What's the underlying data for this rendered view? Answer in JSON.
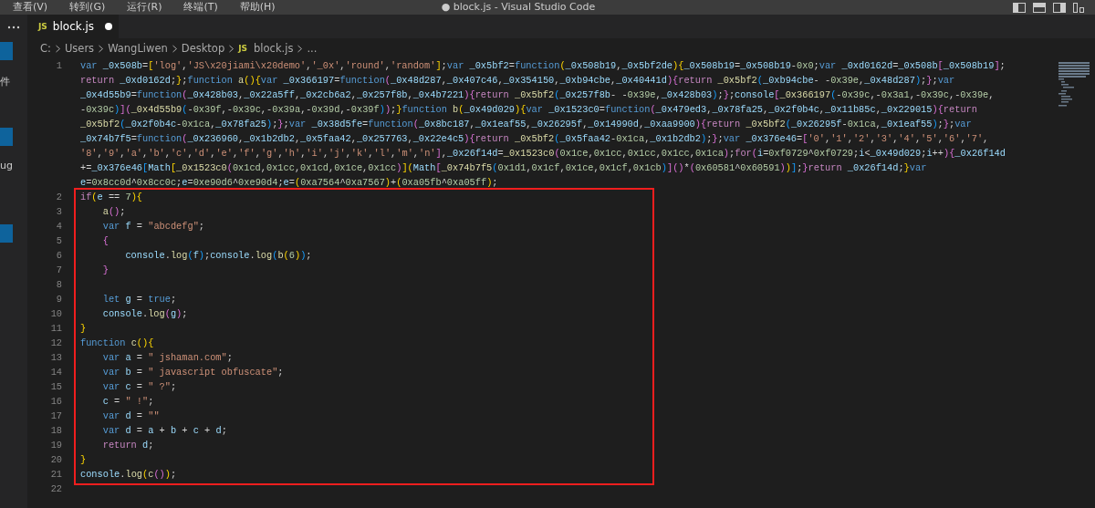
{
  "menu_bar": {
    "items": [
      "查看(V)",
      "转到(G)",
      "运行(R)",
      "终端(T)",
      "帮助(H)"
    ],
    "title": "● block.js - Visual Studio Code"
  },
  "sidebar": {
    "labels": [
      "件",
      "ug"
    ]
  },
  "tabs": [
    {
      "icon_label": "JS",
      "label": "block.js",
      "selected": true,
      "unsaved": true
    }
  ],
  "breadcrumb": [
    {
      "text": "C:"
    },
    {
      "text": "Users"
    },
    {
      "text": "WangLiwen"
    },
    {
      "text": "Desktop"
    },
    {
      "icon_label": "JS",
      "text": "block.js"
    },
    {
      "text": "..."
    }
  ],
  "editor": {
    "lines": [
      {
        "number": "1",
        "rows": [
          "var _0x508b=['log','JS\\x20jiami\\x20demo','_0x','round','random'];var _0x5bf2=function(_0x508b19,_0x5bf2de){_0x508b19=_0x508b19-0x0;var _0xd0162d=_0x508b[_0x508b19];",
          "return _0xd0162d;};function a(){var _0x366197=function(_0x48d287,_0x407c46,_0x354150,_0xb94cbe,_0x40441d){return _0x5bf2(_0xb94cbe- -0x39e,_0x48d287);};var",
          "_0x4d55b9=function(_0x428b03,_0x22a5ff,_0x2cb6a2,_0x257f8b,_0x4b7221){return _0x5bf2(_0x257f8b- -0x39e,_0x428b03);};console[_0x366197(-0x39c,-0x3a1,-0x39c,-0x39e,",
          "-0x39c)](_0x4d55b9(-0x39f,-0x39c,-0x39a,-0x39d,-0x39f));}function b(_0x49d029){var _0x1523c0=function(_0x479ed3,_0x78fa25,_0x2f0b4c,_0x11b85c,_0x229015){return",
          "_0x5bf2(_0x2f0b4c-0x1ca,_0x78fa25);};var _0x38d5fe=function(_0x8bc187,_0x1eaf55,_0x26295f,_0x14990d,_0xaa9900){return _0x5bf2(_0x26295f-0x1ca,_0x1eaf55);};var",
          "_0x74b7f5=function(_0x236960,_0x1b2db2,_0x5faa42,_0x257763,_0x22e4c5){return _0x5bf2(_0x5faa42-0x1ca,_0x1b2db2);};var _0x376e46=['0','1','2','3','4','5','6','7',",
          "'8','9','a','b','c','d','e','f','g','h','i','j','k','l','m','n'],_0x26f14d=_0x1523c0(0x1ce,0x1cc,0x1cc,0x1cc,0x1ca);for(i=0xf0729^0xf0729;i<_0x49d029;i++){_0x26f14d",
          "+=_0x376e46[Math[_0x1523c0(0x1cd,0x1cc,0x1cd,0x1ce,0x1cc)](Math[_0x74b7f5(0x1d1,0x1cf,0x1ce,0x1cf,0x1cb)]()*(0x60581^0x60591))];}return _0x26f14d;}var",
          "e=0x8cc0d^0x8cc0c;e=0xe90d6^0xe90d4;e=(0xa7564^0xa7567)+(0xa05fb^0xa05ff);"
        ]
      },
      {
        "number": "2",
        "rows": [
          "if(e == 7){"
        ]
      },
      {
        "number": "3",
        "rows": [
          "    a();"
        ]
      },
      {
        "number": "4",
        "rows": [
          "    var f = \"abcdefg\";"
        ]
      },
      {
        "number": "5",
        "rows": [
          "    {"
        ]
      },
      {
        "number": "6",
        "rows": [
          "        console.log(f);console.log(b(6));"
        ]
      },
      {
        "number": "7",
        "rows": [
          "    }"
        ]
      },
      {
        "number": "8",
        "rows": [
          ""
        ]
      },
      {
        "number": "9",
        "rows": [
          "    let g = true;"
        ]
      },
      {
        "number": "10",
        "rows": [
          "    console.log(g);"
        ]
      },
      {
        "number": "11",
        "rows": [
          "}"
        ]
      },
      {
        "number": "12",
        "rows": [
          "function c(){"
        ]
      },
      {
        "number": "13",
        "rows": [
          "    var a = \" jshaman.com\";"
        ]
      },
      {
        "number": "14",
        "rows": [
          "    var b = \" javascript obfuscate\";"
        ]
      },
      {
        "number": "15",
        "rows": [
          "    var c = \" ?\";"
        ]
      },
      {
        "number": "16",
        "rows": [
          "    c = \" !\";"
        ]
      },
      {
        "number": "17",
        "rows": [
          "    var d = \"\""
        ]
      },
      {
        "number": "18",
        "rows": [
          "    var d = a + b + c + d;"
        ]
      },
      {
        "number": "19",
        "rows": [
          "    return d;"
        ]
      },
      {
        "number": "20",
        "rows": [
          "}"
        ]
      },
      {
        "number": "21",
        "rows": [
          "console.log(c());"
        ]
      },
      {
        "number": "22",
        "rows": [
          ""
        ]
      }
    ]
  }
}
